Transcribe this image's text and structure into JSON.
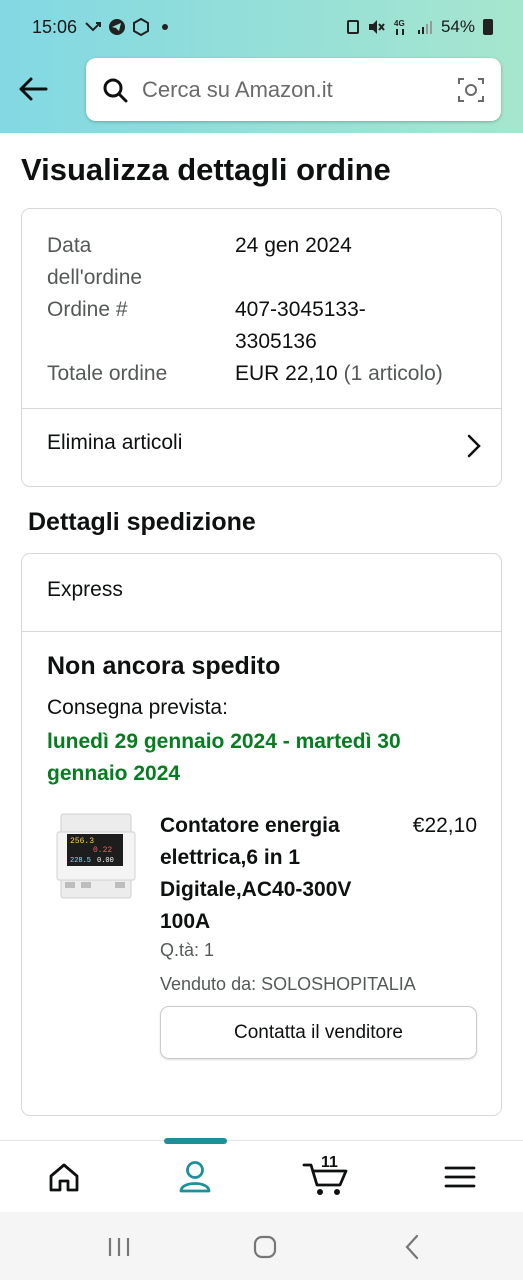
{
  "status_bar": {
    "time": "15:06",
    "battery": "54%"
  },
  "search": {
    "placeholder": "Cerca su Amazon.it"
  },
  "page": {
    "title": "Visualizza dettagli ordine"
  },
  "order_summary": {
    "date_label_line1": "Data",
    "date_label_line2": "dell'ordine",
    "date_value": "24 gen 2024",
    "order_label": "Ordine #",
    "order_value_line1": "407-3045133-",
    "order_value_line2": "3305136",
    "total_label": "Totale ordine",
    "total_value": "EUR 22,10",
    "total_count": "(1 articolo)",
    "delete_items": "Elimina articoli"
  },
  "shipping": {
    "section_title": "Dettagli spedizione",
    "method": "Express",
    "status": "Non ancora spedito",
    "delivery_label": "Consegna prevista:",
    "delivery_date": "lunedì 29 gennaio 2024 - martedì 30 gennaio 2024"
  },
  "product": {
    "title": "Contatore energia elettrica,6 in 1 Digitale,AC40-300V 100A",
    "price": "€22,10",
    "qty": "Q.tà: 1",
    "seller": "Venduto da: SOLOSHOPITALIA",
    "contact_button": "Contatta il venditore",
    "display_values": [
      "256.3",
      "0.22",
      "228.5",
      "0.00"
    ]
  },
  "bottom_nav": {
    "items": [
      {
        "icon": "home-icon"
      },
      {
        "icon": "account-icon",
        "active": true
      },
      {
        "icon": "cart-icon",
        "count": "11"
      },
      {
        "icon": "menu-icon"
      }
    ],
    "accent": "#1e8f9c"
  },
  "colors": {
    "delivery_green": "#067d20",
    "header_start": "#82d8e3",
    "header_end": "#a6e6ce"
  }
}
